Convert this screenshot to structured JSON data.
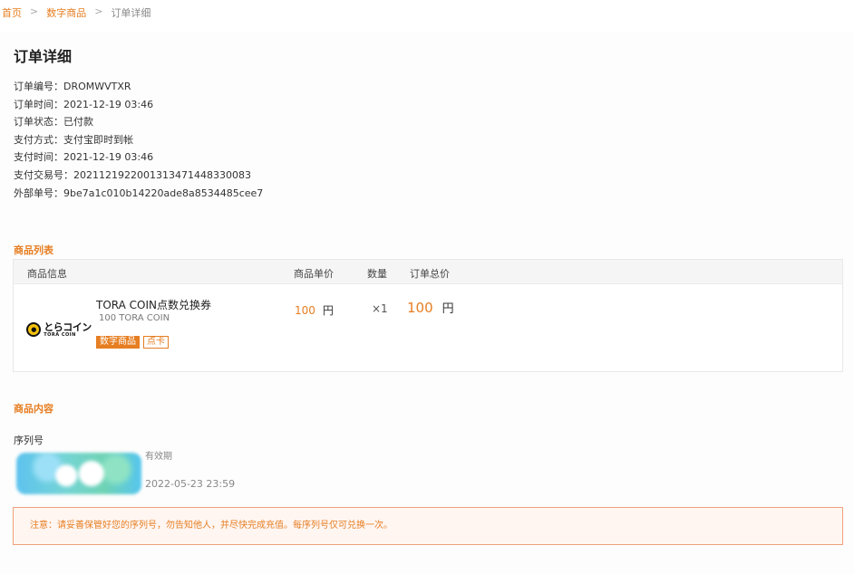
{
  "breadcrumb": {
    "home": "首页",
    "category": "数字商品",
    "current": "订单详细",
    "separator": ">"
  },
  "page_title": "订单详细",
  "order_info": [
    {
      "label": "订单编号：",
      "value": "DROMWVTXR"
    },
    {
      "label": "订单时间：",
      "value": "2021-12-19 03:46"
    },
    {
      "label": "订单状态：",
      "value": "已付款"
    },
    {
      "label": "支付方式：",
      "value": "支付宝即时到帐"
    },
    {
      "label": "支付时间：",
      "value": "2021-12-19 03:46"
    },
    {
      "label": "支付交易号：",
      "value": "2021121922001313471448330083"
    },
    {
      "label": "外部单号：",
      "value": "9be7a1c010b14220ade8a8534485cee7"
    }
  ],
  "goods_section": {
    "title": "商品列表",
    "columns": {
      "info": "商品信息",
      "price": "商品单价",
      "qty": "数量",
      "total": "订单总价"
    },
    "item": {
      "logo_main": "とらコイン",
      "logo_sub": "TORA COIN",
      "name": "TORA COIN点数兑换券",
      "sub": "100 TORA COIN",
      "tags": [
        "数字商品",
        "点卡"
      ],
      "price": "100",
      "price_unit": "円",
      "qty": "×1",
      "total": "100",
      "total_unit": "円"
    }
  },
  "content_section": {
    "title": "商品内容",
    "serial_label": "序列号",
    "valid_label": "有效期",
    "valid_date": "2022-05-23 23:59"
  },
  "notice": "注意：请妥善保管好您的序列号，勿告知他人，并尽快完成充值。每序列号仅可兑换一次。",
  "colors": {
    "accent": "#e67e22",
    "notice_bg": "#fff6f2",
    "notice_border": "#f0a07a"
  }
}
